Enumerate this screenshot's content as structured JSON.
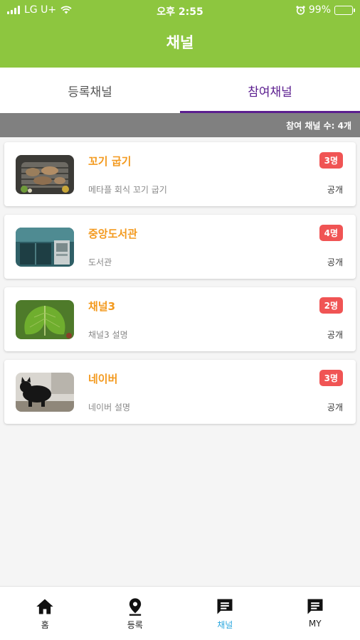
{
  "status_bar": {
    "carrier": "LG U+",
    "time": "오후 2:55",
    "battery": "99%",
    "battery_level": 0.99
  },
  "header": {
    "title": "채널"
  },
  "tabs": [
    {
      "label": "등록채널",
      "active": false
    },
    {
      "label": "참여채널",
      "active": true
    }
  ],
  "count_text": "참여 채널 수: 4개",
  "channels": [
    {
      "title": "꼬기 굽기",
      "description": "메타플 회식 꼬기 굽기",
      "members": "3명",
      "visibility": "공개",
      "thumbnail": "grilled-meat-photo"
    },
    {
      "title": "중앙도서관",
      "description": "도서관",
      "members": "4명",
      "visibility": "공개",
      "thumbnail": "library-window-photo"
    },
    {
      "title": "채널3",
      "description": "채널3  설명",
      "members": "2명",
      "visibility": "공개",
      "thumbnail": "green-leaf-photo"
    },
    {
      "title": "네이버",
      "description": "네이버 설명",
      "members": "3명",
      "visibility": "공개",
      "thumbnail": "black-cat-photo"
    }
  ],
  "bottom_nav": [
    {
      "label": "홈",
      "icon": "home-icon",
      "active": false
    },
    {
      "label": "등록",
      "icon": "location-pin-icon",
      "active": false
    },
    {
      "label": "채널",
      "icon": "chat-icon",
      "active": true
    },
    {
      "label": "MY",
      "icon": "chat-icon",
      "active": false
    }
  ],
  "colors": {
    "header_green": "#8dc63f",
    "active_tab_purple": "#5b1e8f",
    "title_orange": "#f39a1f",
    "badge_red": "#f05454",
    "active_nav_blue": "#2ba7de"
  }
}
